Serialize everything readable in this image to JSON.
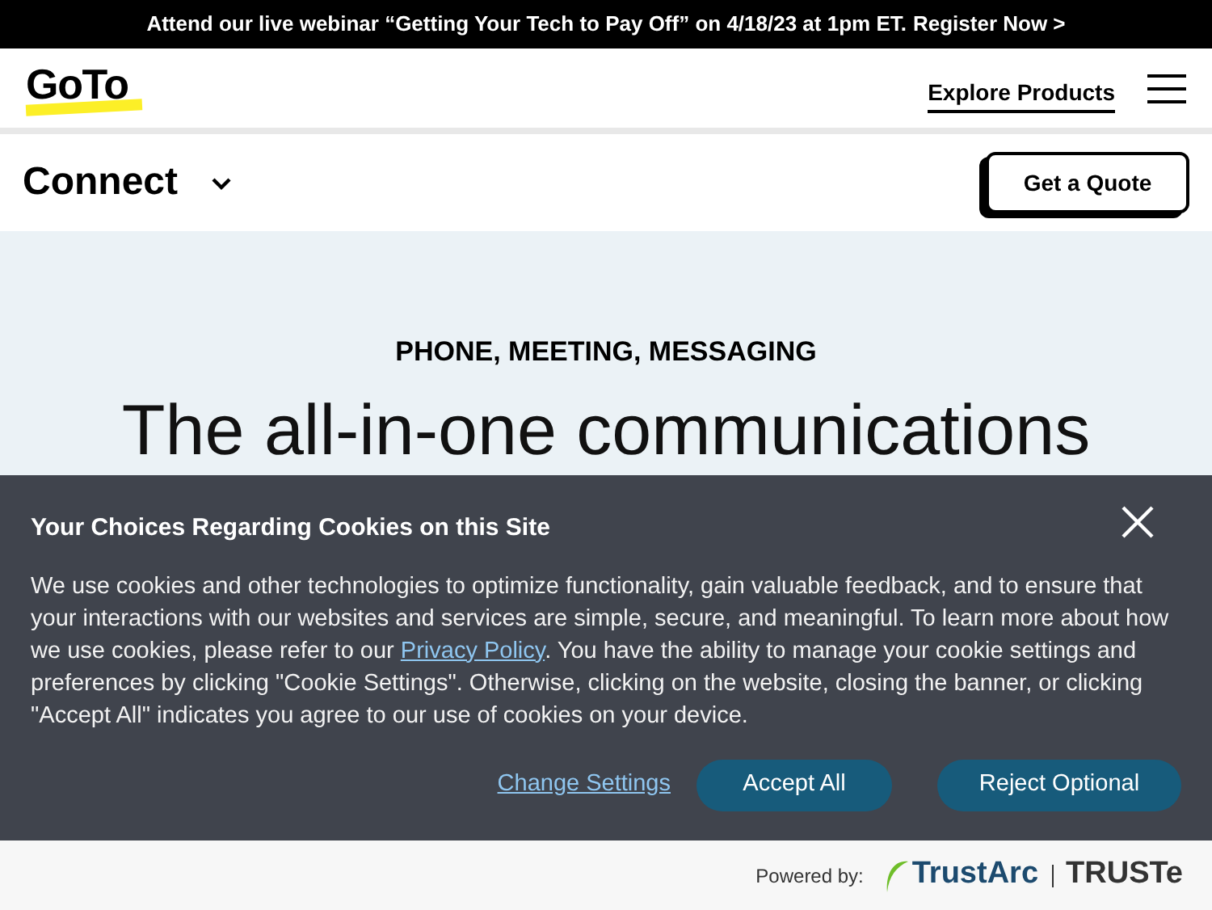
{
  "announcement": {
    "text": "Attend our live webinar “Getting Your Tech to Pay Off” on 4/18/23 at 1pm ET.",
    "link": "Register Now >"
  },
  "header": {
    "logo": "GoTo",
    "explore": "Explore Products"
  },
  "subnav": {
    "product": "Connect",
    "cta": "Get a Quote"
  },
  "hero": {
    "eyebrow": "PHONE, MEETING, MESSAGING",
    "headline": "The all-in-one communications"
  },
  "cookie_banner": {
    "title": "Your Choices Regarding Cookies on this Site",
    "body_before": "We use cookies and other technologies to optimize functionality, gain valuable feedback, and to ensure that your interactions with our websites and services are simple, secure, and meaningful. To learn more about how we use cookies, please refer to our",
    "link": "Privacy Policy",
    "body_after": ". You have the ability to manage your cookie settings and preferences by clicking \"Cookie Settings\". Otherwise, clicking on the website, closing the banner, or clicking \"Accept All\" indicates you agree to our use of cookies on your device.",
    "change_settings": "Change Settings",
    "accept": "Accept All",
    "reject": "Reject Optional"
  },
  "footer": {
    "powered_by": "Powered by:",
    "brand": "TrustArc",
    "brand2": "TRUSTe"
  }
}
